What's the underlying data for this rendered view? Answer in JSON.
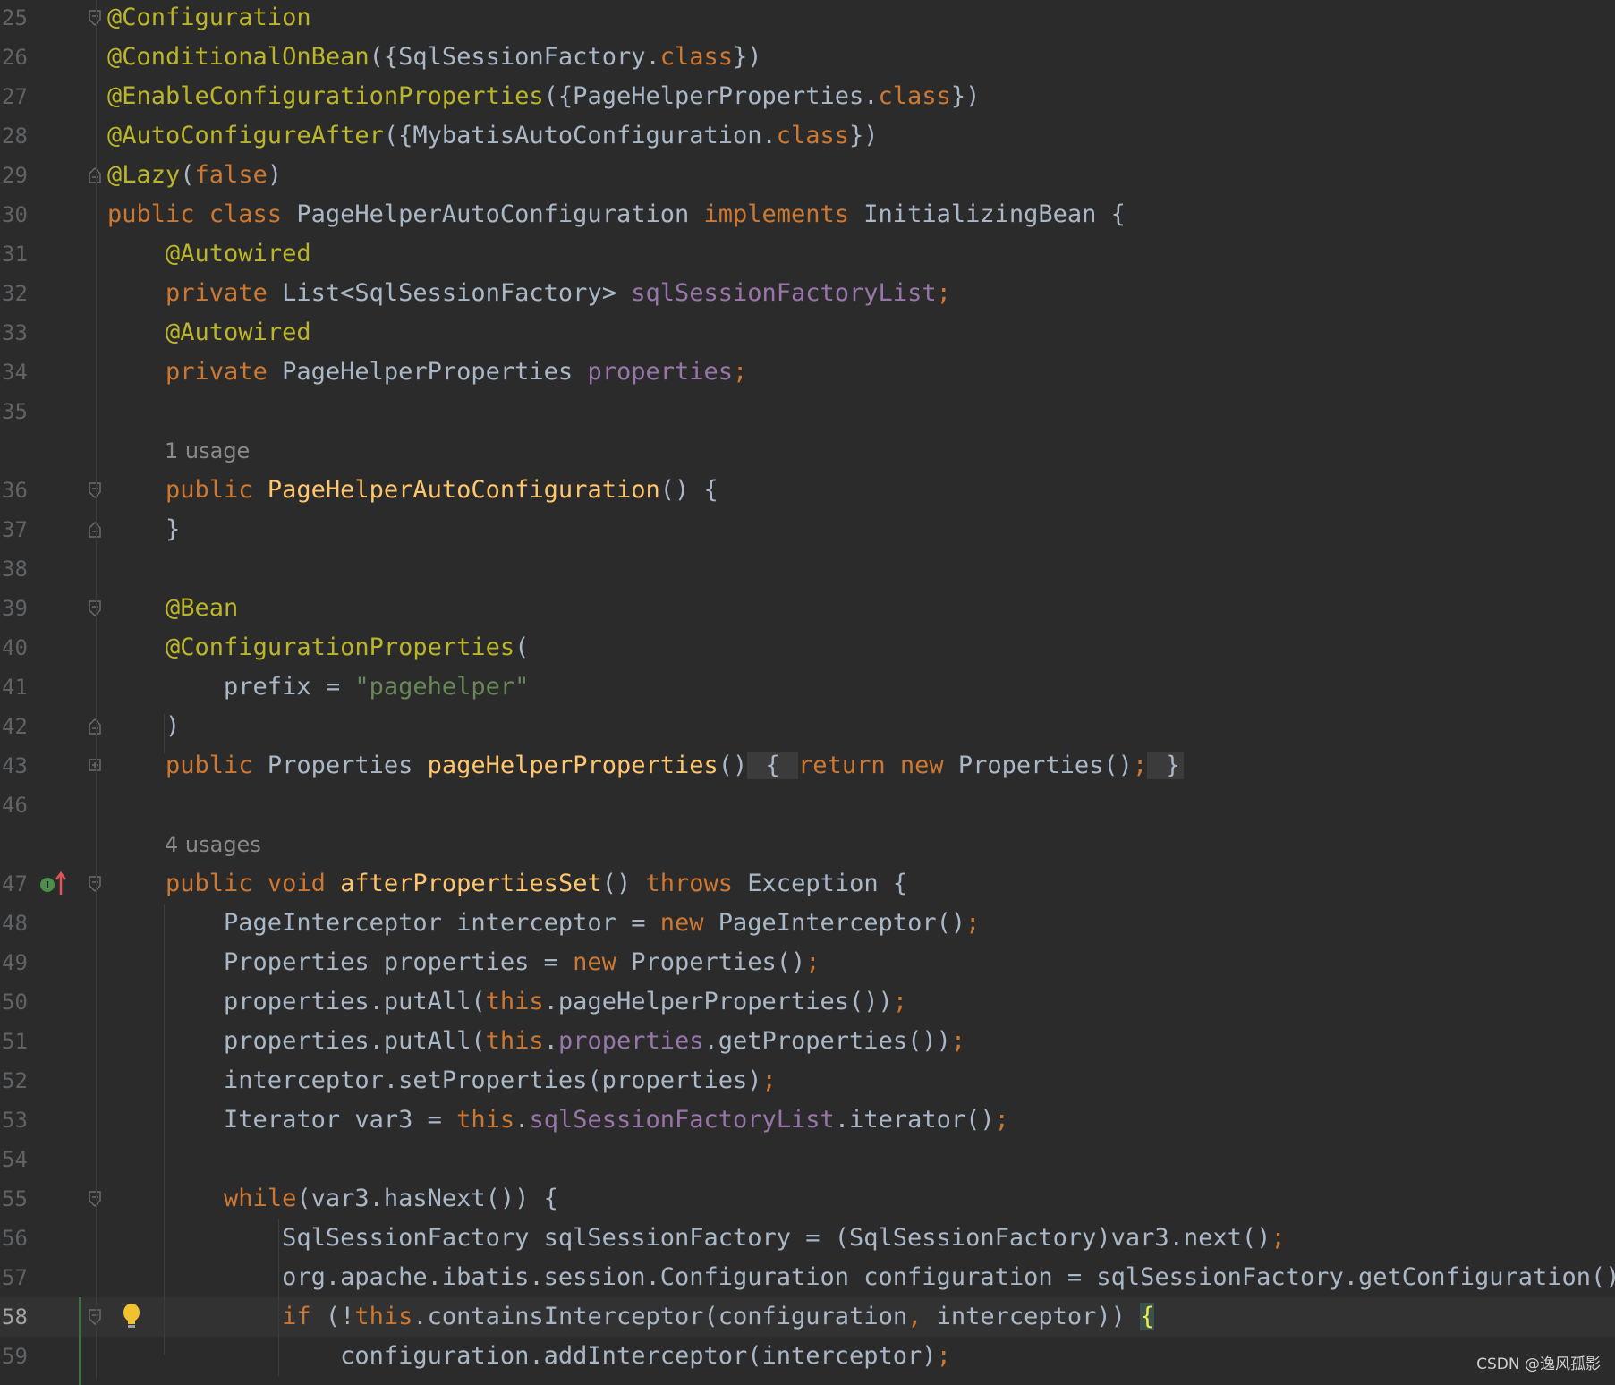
{
  "editor": {
    "lines": [
      {
        "num": "25",
        "tokens": [
          [
            "ann",
            "@Configuration"
          ]
        ]
      },
      {
        "num": "26",
        "tokens": [
          [
            "ann",
            "@ConditionalOnBean"
          ],
          [
            "plain",
            "({SqlSessionFactory."
          ],
          [
            "kw",
            "class"
          ],
          [
            "plain",
            "})"
          ]
        ]
      },
      {
        "num": "27",
        "tokens": [
          [
            "ann",
            "@EnableConfigurationProperties"
          ],
          [
            "plain",
            "({PageHelperProperties."
          ],
          [
            "kw",
            "class"
          ],
          [
            "plain",
            "})"
          ]
        ]
      },
      {
        "num": "28",
        "tokens": [
          [
            "ann",
            "@AutoConfigureAfter"
          ],
          [
            "plain",
            "({MybatisAutoConfiguration."
          ],
          [
            "kw",
            "class"
          ],
          [
            "plain",
            "})"
          ]
        ]
      },
      {
        "num": "29",
        "tokens": [
          [
            "ann",
            "@Lazy"
          ],
          [
            "plain",
            "("
          ],
          [
            "kw",
            "false"
          ],
          [
            "plain",
            ")"
          ]
        ]
      },
      {
        "num": "30",
        "tokens": [
          [
            "kw",
            "public class "
          ],
          [
            "plain",
            "PageHelperAutoConfiguration "
          ],
          [
            "kw",
            "implements "
          ],
          [
            "plain",
            "InitializingBean {"
          ]
        ]
      },
      {
        "num": "31",
        "tokens": [
          [
            "plain",
            "    "
          ],
          [
            "ann",
            "@Autowired"
          ]
        ]
      },
      {
        "num": "32",
        "tokens": [
          [
            "plain",
            "    "
          ],
          [
            "kw",
            "private "
          ],
          [
            "plain",
            "List<SqlSessionFactory> "
          ],
          [
            "fld",
            "sqlSessionFactoryList"
          ],
          [
            "kw",
            ";"
          ]
        ]
      },
      {
        "num": "33",
        "tokens": [
          [
            "plain",
            "    "
          ],
          [
            "ann",
            "@Autowired"
          ]
        ]
      },
      {
        "num": "34",
        "tokens": [
          [
            "plain",
            "    "
          ],
          [
            "kw",
            "private "
          ],
          [
            "plain",
            "PageHelperProperties "
          ],
          [
            "fld",
            "properties"
          ],
          [
            "kw",
            ";"
          ]
        ]
      },
      {
        "num": "35",
        "tokens": []
      },
      {
        "hint": "1 usage"
      },
      {
        "num": "36",
        "tokens": [
          [
            "plain",
            "    "
          ],
          [
            "kw",
            "public "
          ],
          [
            "fn",
            "PageHelperAutoConfiguration"
          ],
          [
            "plain",
            "() {"
          ]
        ]
      },
      {
        "num": "37",
        "tokens": [
          [
            "plain",
            "    }"
          ]
        ]
      },
      {
        "num": "38",
        "tokens": []
      },
      {
        "num": "39",
        "tokens": [
          [
            "plain",
            "    "
          ],
          [
            "ann",
            "@Bean"
          ]
        ]
      },
      {
        "num": "40",
        "tokens": [
          [
            "plain",
            "    "
          ],
          [
            "ann",
            "@ConfigurationProperties"
          ],
          [
            "plain",
            "("
          ]
        ]
      },
      {
        "num": "41",
        "tokens": [
          [
            "plain",
            "        prefix = "
          ],
          [
            "str",
            "\"pagehelper\""
          ]
        ]
      },
      {
        "num": "42",
        "tokens": [
          [
            "plain",
            "    )"
          ]
        ]
      },
      {
        "num": "43",
        "tokens": [
          [
            "plain",
            "    "
          ],
          [
            "kw",
            "public "
          ],
          [
            "plain",
            "Properties "
          ],
          [
            "fn",
            "pageHelperProperties"
          ],
          [
            "plain",
            "()"
          ],
          [
            "collapsed",
            " { "
          ],
          [
            "kw",
            "return new "
          ],
          [
            "plain",
            "Properties()"
          ],
          [
            "kw",
            ";"
          ],
          [
            "collapsed",
            " }"
          ]
        ]
      },
      {
        "num": "46",
        "tokens": []
      },
      {
        "hint": "4 usages"
      },
      {
        "num": "47",
        "tokens": [
          [
            "plain",
            "    "
          ],
          [
            "kw",
            "public void "
          ],
          [
            "fn",
            "afterPropertiesSet"
          ],
          [
            "plain",
            "() "
          ],
          [
            "kw",
            "throws "
          ],
          [
            "plain",
            "Exception {"
          ]
        ]
      },
      {
        "num": "48",
        "tokens": [
          [
            "plain",
            "        PageInterceptor interceptor = "
          ],
          [
            "kw",
            "new "
          ],
          [
            "plain",
            "PageInterceptor()"
          ],
          [
            "kw",
            ";"
          ]
        ]
      },
      {
        "num": "49",
        "tokens": [
          [
            "plain",
            "        Properties properties = "
          ],
          [
            "kw",
            "new "
          ],
          [
            "plain",
            "Properties()"
          ],
          [
            "kw",
            ";"
          ]
        ]
      },
      {
        "num": "50",
        "tokens": [
          [
            "plain",
            "        properties.putAll("
          ],
          [
            "kw",
            "this"
          ],
          [
            "plain",
            ".pageHelperProperties())"
          ],
          [
            "kw",
            ";"
          ]
        ]
      },
      {
        "num": "51",
        "tokens": [
          [
            "plain",
            "        properties.putAll("
          ],
          [
            "kw",
            "this"
          ],
          [
            "plain",
            "."
          ],
          [
            "fld",
            "properties"
          ],
          [
            "plain",
            ".getProperties())"
          ],
          [
            "kw",
            ";"
          ]
        ]
      },
      {
        "num": "52",
        "tokens": [
          [
            "plain",
            "        interceptor.setProperties(properties)"
          ],
          [
            "kw",
            ";"
          ]
        ]
      },
      {
        "num": "53",
        "tokens": [
          [
            "plain",
            "        Iterator var3 = "
          ],
          [
            "kw",
            "this"
          ],
          [
            "plain",
            "."
          ],
          [
            "fld",
            "sqlSessionFactoryList"
          ],
          [
            "plain",
            ".iterator()"
          ],
          [
            "kw",
            ";"
          ]
        ]
      },
      {
        "num": "54",
        "tokens": []
      },
      {
        "num": "55",
        "tokens": [
          [
            "plain",
            "        "
          ],
          [
            "kw",
            "while"
          ],
          [
            "plain",
            "(var3.hasNext()) {"
          ]
        ]
      },
      {
        "num": "56",
        "tokens": [
          [
            "plain",
            "            SqlSessionFactory sqlSessionFactory = (SqlSessionFactory)var3.next()"
          ],
          [
            "kw",
            ";"
          ]
        ]
      },
      {
        "num": "57",
        "tokens": [
          [
            "plain",
            "            org.apache.ibatis.session.Configuration configuration = sqlSessionFactory.getConfiguration()"
          ],
          [
            "kw",
            ";"
          ]
        ]
      },
      {
        "num": "58",
        "tokens": [
          [
            "plain",
            "            "
          ],
          [
            "kw",
            "if "
          ],
          [
            "plain",
            "(!"
          ],
          [
            "kw",
            "this"
          ],
          [
            "plain",
            ".containsInterceptor(configuration"
          ],
          [
            "kw",
            ", "
          ],
          [
            "plain",
            "interceptor)) "
          ],
          [
            "brace",
            "{"
          ]
        ]
      },
      {
        "num": "59",
        "tokens": [
          [
            "plain",
            "                configuration.addInterceptor(interceptor)"
          ],
          [
            "kw",
            ";"
          ]
        ]
      }
    ]
  },
  "gutter": {
    "override_icon": "implements-override-icon",
    "bulb_icon": "intention-bulb-icon"
  },
  "colors": {
    "background": "#2b2b2b",
    "annotation": "#bbb529",
    "keyword": "#cc7832",
    "field": "#9876aa",
    "method": "#ffc66d",
    "string": "#6a8759",
    "text": "#a9b7c6"
  },
  "watermark": "CSDN @逸风孤影"
}
